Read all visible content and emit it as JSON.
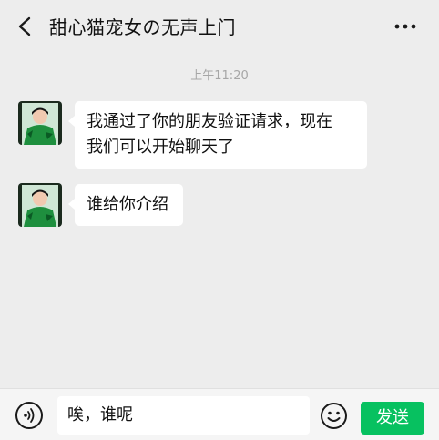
{
  "header": {
    "title": "甜心猫宠女の无声上门",
    "back_icon": "chevron-left-icon",
    "more_icon": "more-dots-icon"
  },
  "chat": {
    "timestamp": "上午11:20",
    "messages": [
      {
        "sender": "contact",
        "lines": [
          "我通过了你的朋友验证请求，现在",
          "我们可以开始聊天了"
        ]
      },
      {
        "sender": "contact",
        "lines": [
          "谁给你介绍"
        ]
      }
    ]
  },
  "input_bar": {
    "voice_icon": "voice-icon",
    "input_value": "唉，谁呢",
    "emoji_icon": "smiley-icon",
    "send_label": "发送"
  },
  "colors": {
    "background": "#ededed",
    "bubble": "#ffffff",
    "send_button": "#07c160",
    "timestamp_text": "#a6a6a6"
  }
}
